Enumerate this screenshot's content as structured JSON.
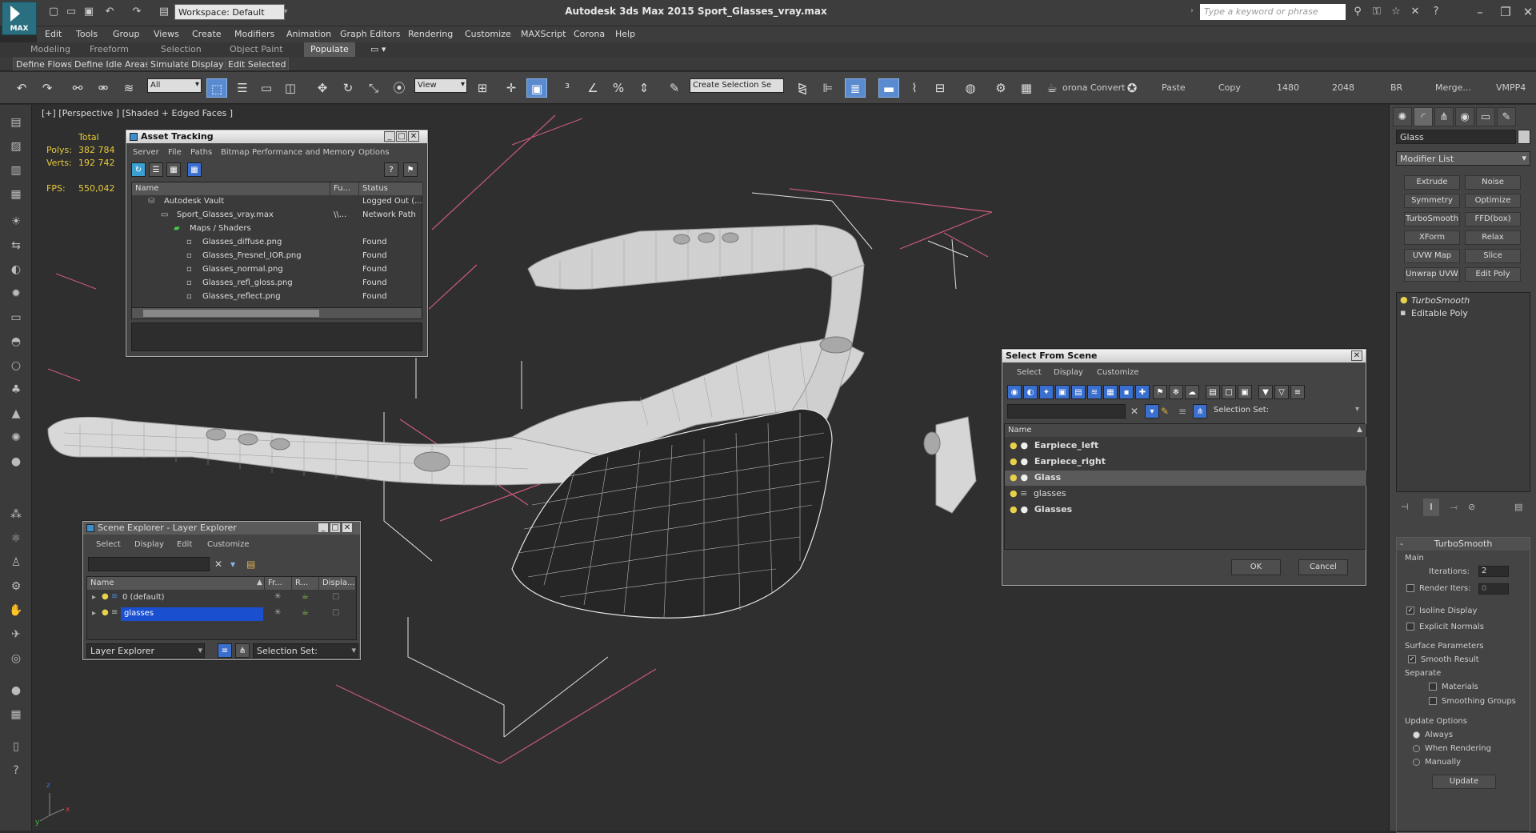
{
  "title_bar": {
    "logo_label": "MAX",
    "workspace": "Workspace: Default",
    "window_title": "Autodesk 3ds Max  2015    Sport_Glasses_vray.max",
    "search_placeholder": "Type a keyword or phrase"
  },
  "menu": [
    "Edit",
    "Tools",
    "Group",
    "Views",
    "Create",
    "Modifiers",
    "Animation",
    "Graph Editors",
    "Rendering",
    "Customize",
    "MAXScript",
    "Corona",
    "Help"
  ],
  "ribbon_tabs": [
    "Modeling",
    "Freeform",
    "Selection",
    "Object Paint",
    "Populate"
  ],
  "ribbon_active": "Populate",
  "ribbon_items": [
    "Define Flows",
    "Define Idle Areas",
    "Simulate",
    "Display",
    "Edit Selected"
  ],
  "toolbar": {
    "filter": "All",
    "view": "View",
    "selection_set": "Create Selection Se",
    "corona_convert": "orona Convert",
    "paste": "Paste",
    "copy": "Copy",
    "res1": "1480",
    "res2": "2048",
    "br": "BR",
    "merge": "Merge...",
    "vmpp": "VMPP4"
  },
  "viewport": {
    "label": "[+] [Perspective ] [Shaded + Edged Faces ]",
    "stats": {
      "total_label": "Total",
      "polys_label": "Polys:",
      "polys_value": "382 784",
      "verts_label": "Verts:",
      "verts_value": "192 742",
      "fps_label": "FPS:",
      "fps_value": "550,042"
    },
    "axis_x": "x",
    "axis_y": "y",
    "axis_z": "z"
  },
  "asset_tracking": {
    "title": "Asset Tracking",
    "menus": [
      "Server",
      "File",
      "Paths",
      "Bitmap Performance and Memory",
      "Options"
    ],
    "columns": [
      "Name",
      "Fu...",
      "Status"
    ],
    "rows": [
      {
        "name": "Autodesk Vault",
        "full": "",
        "status": "Logged Out (..."
      },
      {
        "name": "Sport_Glasses_vray.max",
        "full": "\\\\...",
        "status": "Network Path"
      },
      {
        "name": "Maps / Shaders",
        "full": "",
        "status": ""
      },
      {
        "name": "Glasses_diffuse.png",
        "full": "",
        "status": "Found"
      },
      {
        "name": "Glasses_Fresnel_IOR.png",
        "full": "",
        "status": "Found"
      },
      {
        "name": "Glasses_normal.png",
        "full": "",
        "status": "Found"
      },
      {
        "name": "Glasses_refl_gloss.png",
        "full": "",
        "status": "Found"
      },
      {
        "name": "Glasses_reflect.png",
        "full": "",
        "status": "Found"
      }
    ]
  },
  "scene_explorer": {
    "title": "Scene Explorer - Layer Explorer",
    "menus": [
      "Select",
      "Display",
      "Edit",
      "Customize"
    ],
    "columns": [
      "Name",
      "Fr...",
      "R...",
      "Displa..."
    ],
    "rows": [
      "0 (default)",
      "glasses"
    ],
    "selected": "glasses",
    "footer_mode": "Layer Explorer",
    "selection_set_label": "Selection Set:"
  },
  "select_from_scene": {
    "title": "Select From Scene",
    "menus": [
      "Select",
      "Display",
      "Customize"
    ],
    "selection_set_label": "Selection Set:",
    "column_name": "Name",
    "items": [
      "Earpiece_left",
      "Earpiece_right",
      "Glass",
      "glasses",
      "Glasses"
    ],
    "selected": "Glass",
    "ok": "OK",
    "cancel": "Cancel"
  },
  "command_panel": {
    "object_name": "Glass",
    "modifier_list": "Modifier List",
    "modifier_buttons": [
      "Extrude",
      "Noise",
      "Symmetry",
      "Optimize",
      "TurboSmooth",
      "FFD(box)",
      "XForm",
      "Relax",
      "UVW Map",
      "Slice",
      "Unwrap UVW",
      "Edit Poly"
    ],
    "stack": [
      "TurboSmooth",
      "Editable Poly"
    ],
    "turbosmooth": {
      "header": "TurboSmooth",
      "main_label": "Main",
      "iterations_label": "Iterations:",
      "iterations_value": "2",
      "render_iters_label": "Render Iters:",
      "render_iters_value": "0",
      "isoline_display": "Isoline Display",
      "explicit_normals": "Explicit Normals",
      "surface_params": "Surface Parameters",
      "smooth_result": "Smooth Result",
      "separate": "Separate",
      "materials": "Materials",
      "smoothing_groups": "Smoothing Groups",
      "update_options": "Update Options",
      "always": "Always",
      "when_rendering": "When Rendering",
      "manually": "Manually",
      "update_button": "Update"
    }
  },
  "colors": {
    "selection_blue": "#1a4fd0",
    "stats_yellow": "#e8c93a",
    "bbox_pink": "#d05a7a",
    "mesh_white": "#e4e4e4"
  }
}
